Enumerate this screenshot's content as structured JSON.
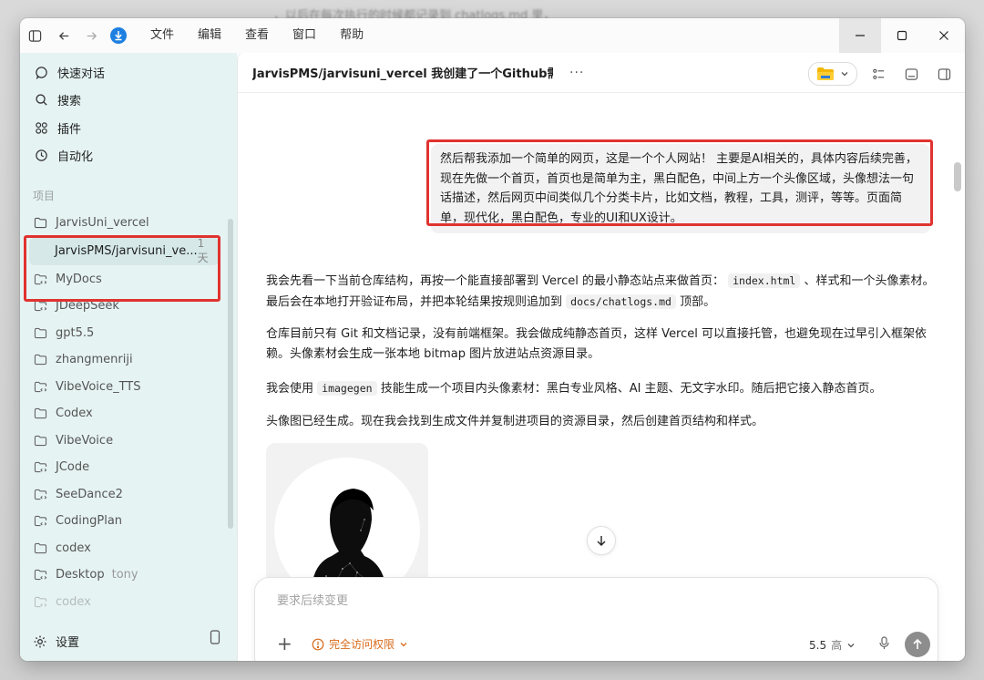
{
  "background_text": "，以后在每次执行的时候都记录到 chatlogs.md 里，",
  "menu": {
    "items": [
      "文件",
      "编辑",
      "查看",
      "窗口",
      "帮助"
    ]
  },
  "sidebar": {
    "nav": [
      {
        "label": "快速对话",
        "icon": "chat-bubble-icon"
      },
      {
        "label": "搜索",
        "icon": "search-icon"
      },
      {
        "label": "插件",
        "icon": "plugins-grid-icon"
      },
      {
        "label": "自动化",
        "icon": "clock-icon"
      }
    ],
    "section_label": "项目",
    "projects": [
      {
        "label": "JarvisUni_vercel",
        "kind": "folder"
      },
      {
        "label": "JarvisPMS/jarvisuni_ve...",
        "age": "1 天",
        "kind": "child"
      },
      {
        "label": "MyDocs",
        "kind": "repo"
      },
      {
        "label": "JDeepSeek",
        "kind": "repo"
      },
      {
        "label": "gpt5.5",
        "kind": "folder"
      },
      {
        "label": "zhangmenriji",
        "kind": "folder"
      },
      {
        "label": "VibeVoice_TTS",
        "kind": "repo"
      },
      {
        "label": "Codex",
        "kind": "folder"
      },
      {
        "label": "VibeVoice",
        "kind": "folder"
      },
      {
        "label": "JCode",
        "kind": "repo"
      },
      {
        "label": "SeeDance2",
        "kind": "repo"
      },
      {
        "label": "CodingPlan",
        "kind": "repo"
      },
      {
        "label": "codex",
        "kind": "folder"
      },
      {
        "label": "Desktop",
        "sub": "tony",
        "kind": "repo"
      },
      {
        "label": "codex",
        "kind": "repo"
      }
    ],
    "settings_label": "设置"
  },
  "main": {
    "title": "JarvisPMS/jarvisuni_vercel 我创建了一个Github需要...",
    "user_message": "然后帮我添加一个简单的网页，这是一个个人网站！ 主要是AI相关的，具体内容后续完善，现在先做一个首页，首页也是简单为主，黑白配色，中间上方一个头像区域，头像想法一句话描述，然后网页中间类似几个分类卡片，比如文档，教程，工具，测评，等等。页面简单，现代化，黑白配色，专业的UI和UX设计。",
    "p1": {
      "a": "我会先看一下当前仓库结构，再按一个能直接部署到 Vercel 的最小静态站点来做首页：",
      "code1": "index.html",
      "b": "、样式和一个头像素材。最后会在本地打开验证布局，并把本轮结果按规则追加到",
      "code2": "docs/chatlogs.md",
      "c": "顶部。"
    },
    "p2": "仓库目前只有 Git 和文档记录，没有前端框架。我会做成纯静态首页，这样 Vercel 可以直接托管，也避免现在过早引入框架依赖。头像素材会生成一张本地 bitmap 图片放进站点资源目录。",
    "p3": {
      "a": "我会使用",
      "code": "imagegen",
      "b": "技能生成一个项目内头像素材：黑白专业风格、AI 主题、无文字水印。随后把它接入静态首页。"
    },
    "p4": "头像图已经生成。现在我会找到生成文件并复制进项目的资源目录，然后创建首页结构和样式。"
  },
  "composer": {
    "placeholder": "要求后续变更",
    "permission_label": "完全访问权限",
    "model": "5.5",
    "effort": "高"
  },
  "colors": {
    "sidebar_bg": "#e6f3f3",
    "highlight_red": "#e0332f",
    "permission_orange": "#d86a1b",
    "accent_blue": "#1d7fe0"
  }
}
